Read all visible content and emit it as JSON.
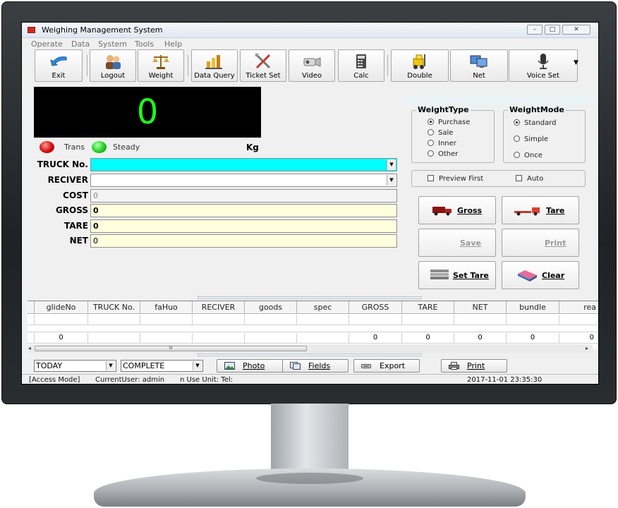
{
  "window": {
    "title": "Weighing Management System",
    "buttons": {
      "minimize": "–",
      "restore": "□",
      "close": "✕"
    }
  },
  "menu": [
    "Operate",
    "Data",
    "System",
    "Tools",
    "Help"
  ],
  "toolbar": [
    {
      "label": "Exit",
      "icon": "exit-arrow-icon"
    },
    {
      "label": "Logout",
      "icon": "users-icon"
    },
    {
      "label": "Weight",
      "icon": "scale-icon"
    },
    {
      "label": "Data Query",
      "icon": "chart-icon"
    },
    {
      "label": "Ticket Set",
      "icon": "tools-icon"
    },
    {
      "label": "Video",
      "icon": "camera-icon"
    },
    {
      "label": "Calc",
      "icon": "calculator-icon"
    },
    {
      "label": "Double",
      "icon": "forklift-icon"
    },
    {
      "label": "Net",
      "icon": "monitors-icon"
    },
    {
      "label": "Voice Set",
      "icon": "microphone-icon"
    }
  ],
  "display": {
    "weight": "0",
    "unit": "Kg",
    "trans_label": "Trans",
    "steady_label": "Steady"
  },
  "form": {
    "truck_no": {
      "label": "TRUCK No.",
      "value": ""
    },
    "reciver": {
      "label": "RECIVER",
      "value": ""
    },
    "cost": {
      "label": "COST",
      "value": "0"
    },
    "gross": {
      "label": "GROSS",
      "value": "0"
    },
    "tare": {
      "label": "TARE",
      "value": "0"
    },
    "net": {
      "label": "NET",
      "value": "0"
    }
  },
  "weight_type": {
    "title": "WeightType",
    "options": [
      "Purchase",
      "Sale",
      "Inner",
      "Other"
    ],
    "selected": "Purchase"
  },
  "weight_mode": {
    "title": "WeightMode",
    "options": [
      "Standard",
      "Simple",
      "Once"
    ],
    "selected": "Standard"
  },
  "checks": {
    "preview_first": "Preview First",
    "auto": "Auto"
  },
  "actions": {
    "gross": "Gross",
    "tare": "Tare",
    "save": "Save",
    "print": "Print",
    "set_tare": "Set Tare",
    "clear": "Clear"
  },
  "grid": {
    "columns": [
      "glideNo",
      "TRUCK No.",
      "faHuo",
      "RECIVER",
      "goods",
      "spec",
      "GROSS",
      "TARE",
      "NET",
      "bundle",
      "rea"
    ],
    "rows": [
      [
        "",
        "",
        "",
        "",
        "",
        "",
        "",
        "",
        "",
        "",
        ""
      ],
      [
        "0",
        "",
        "",
        "",
        "",
        "",
        "0",
        "0",
        "0",
        "0",
        "0"
      ]
    ],
    "scroll_grip": "III"
  },
  "bottom": {
    "date_filter": "TODAY",
    "status_filter": "COMPLETE",
    "photo": "Photo",
    "fields": "Fields",
    "export": "Export",
    "print": "Print"
  },
  "status": {
    "mode": "[Access Mode]",
    "user": "CurrentUser: admin",
    "unit": "n Use Unit: Tel:",
    "datetime": "2017-11-01 23:35:30"
  },
  "colors": {
    "display_bg": "#000000",
    "display_digit": "#1aff1a",
    "truck_field": "#00ffff",
    "value_field": "#ffffdd",
    "led_trans": "#d20b0b",
    "led_steady": "#1fcf1f"
  }
}
